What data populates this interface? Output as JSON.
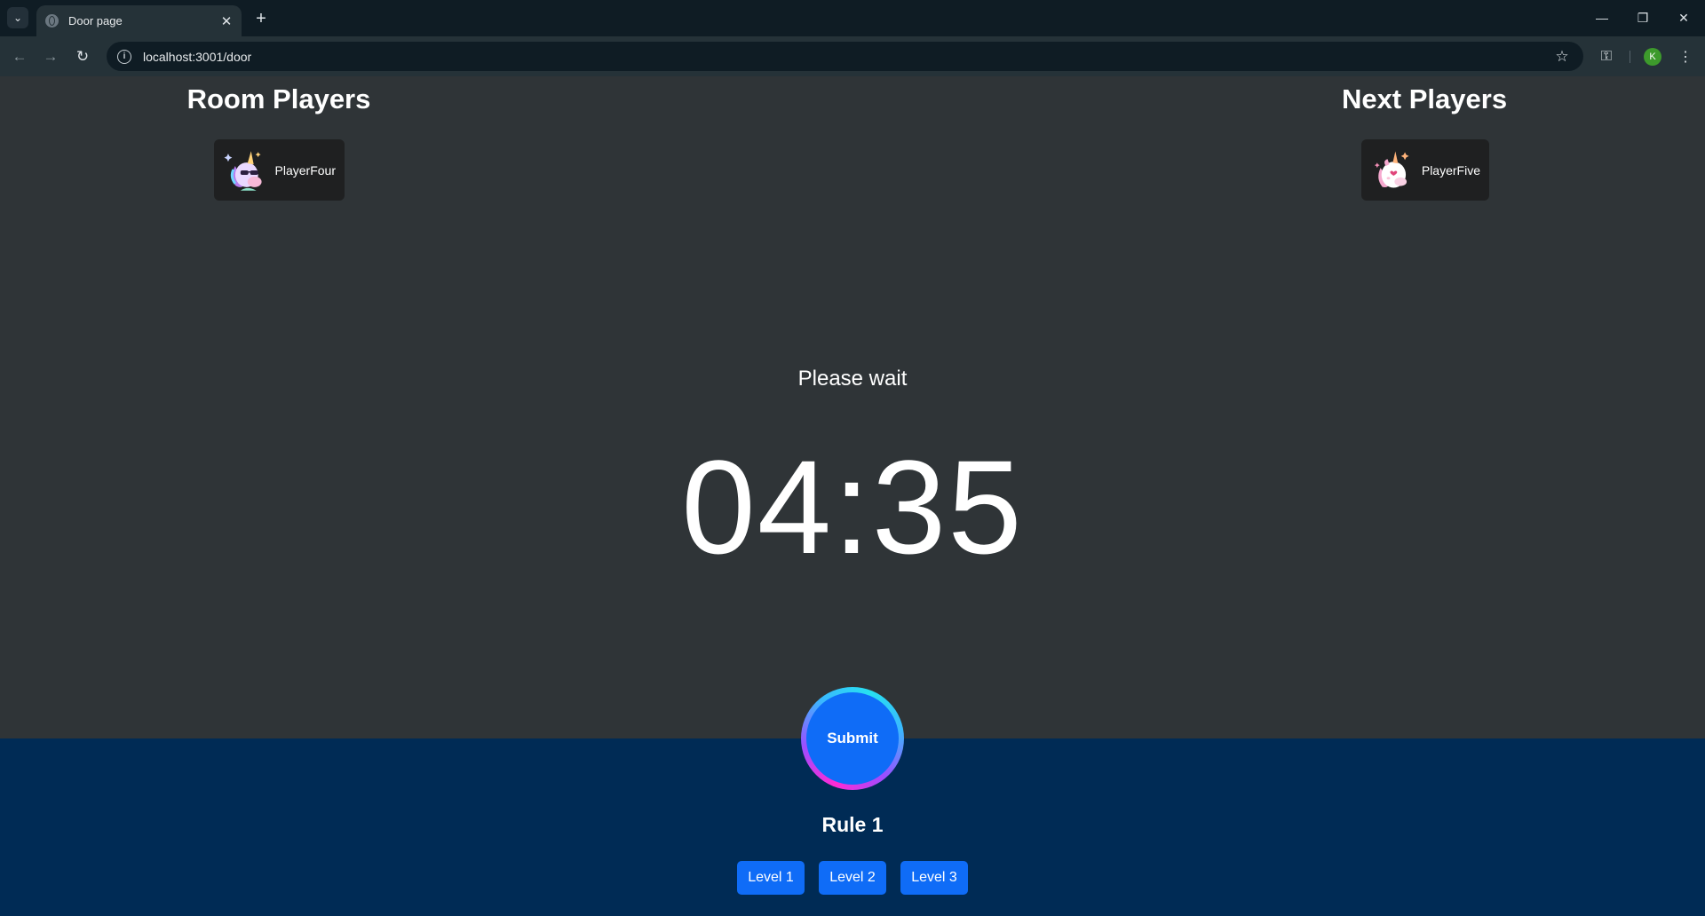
{
  "browser": {
    "tab_title": "Door page",
    "url": "localhost:3001/door",
    "profile_initial": "K"
  },
  "page": {
    "room_players": {
      "heading": "Room Players",
      "players": [
        {
          "name": "PlayerFour",
          "avatar": "unicorn-sunglasses-icon"
        }
      ]
    },
    "next_players": {
      "heading": "Next Players",
      "players": [
        {
          "name": "PlayerFive",
          "avatar": "unicorn-heart-icon"
        }
      ]
    },
    "status_text": "Please wait",
    "timer": "04:35",
    "submit_label": "Submit",
    "rule_text": "Rule 1",
    "levels": [
      "Level 1",
      "Level 2",
      "Level 3"
    ]
  },
  "colors": {
    "page_background": "#2f3437",
    "footer_background": "#002b55",
    "accent_button": "#0f6cf7",
    "card_background": "#1f2021"
  }
}
